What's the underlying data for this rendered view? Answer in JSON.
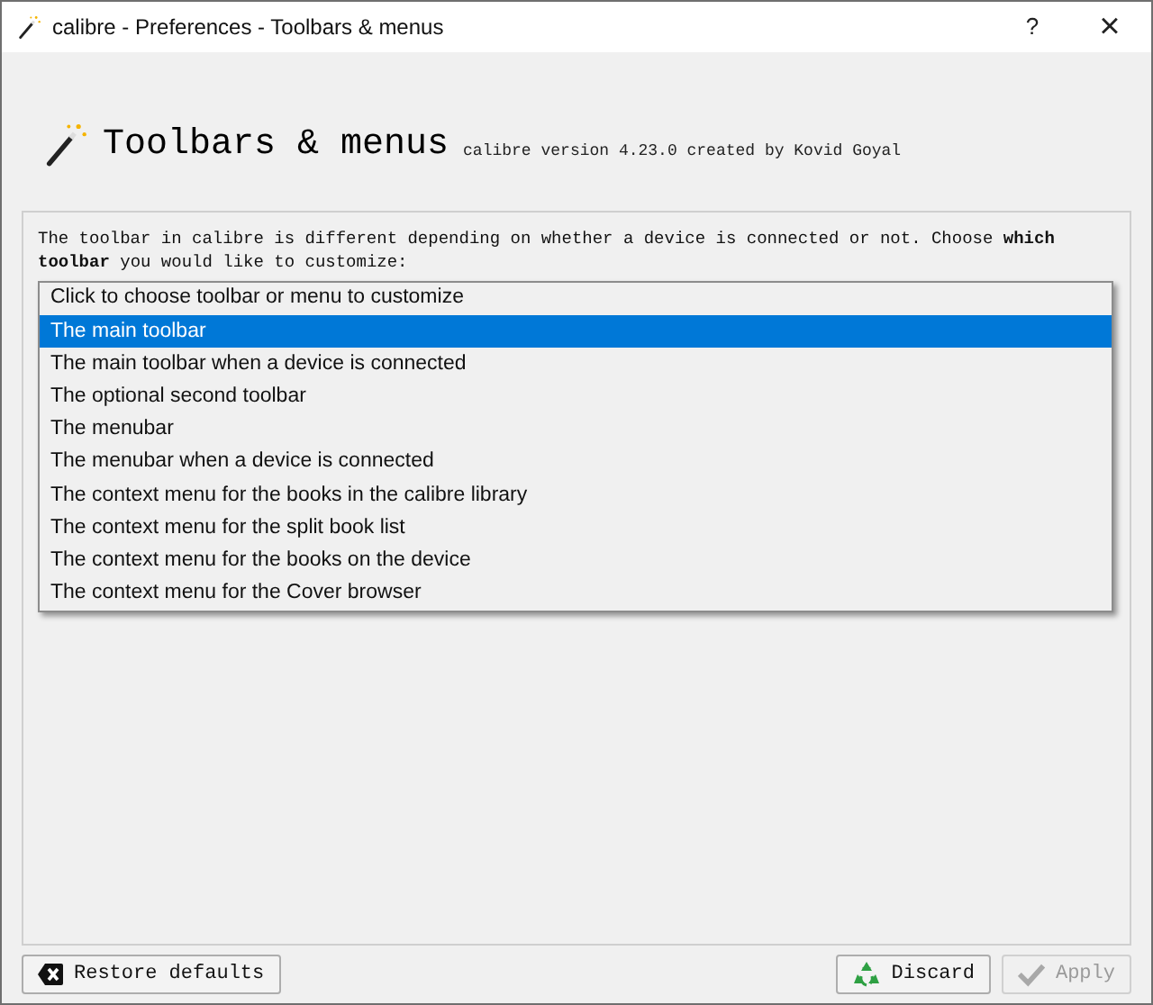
{
  "window": {
    "title": "calibre - Preferences - Toolbars & menus",
    "help": "?",
    "close": "×"
  },
  "header": {
    "title": "Toolbars & menus",
    "subtitle": "calibre version 4.23.0 created by Kovid Goyal"
  },
  "description": "The toolbar in calibre is different depending on whether a device is connected or not. Choose **which toolbar** you would like to customize:",
  "dropdown_list": [
    {
      "label": "Click to choose toolbar or menu to customize",
      "selected": false
    },
    {
      "label": "The main toolbar",
      "selected": true
    },
    {
      "label": "The main toolbar when a device is connected",
      "selected": false
    },
    {
      "label": "The optional second toolbar",
      "selected": false
    },
    {
      "label": "The menubar",
      "selected": false
    },
    {
      "label": "The menubar when a device is connected",
      "selected": false
    },
    {
      "label": "The context menu for the books in the calibre library",
      "selected": false
    },
    {
      "label": "The context menu for the split book list",
      "selected": false
    },
    {
      "label": "The context menu for the books on the device",
      "selected": false
    },
    {
      "label": "The context menu for the Cover browser",
      "selected": false
    }
  ],
  "buttons": [
    {
      "label": "Restore defaults",
      "kind": "restore",
      "disabled": false
    },
    {
      "label": "Discard",
      "kind": "discard",
      "disabled": false
    },
    {
      "label": "Apply",
      "kind": "apply",
      "disabled": true
    }
  ]
}
